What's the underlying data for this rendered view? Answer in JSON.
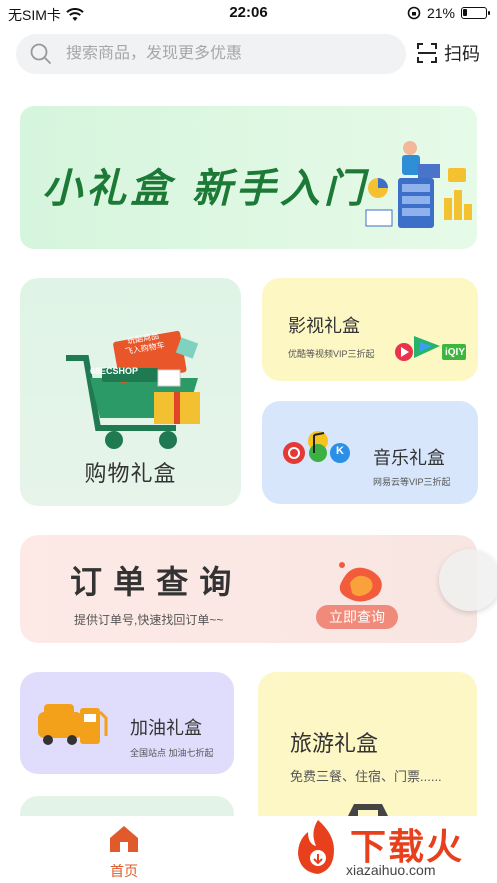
{
  "status_bar": {
    "carrier": "无SIM卡",
    "time": "22:06",
    "battery_text": "21%",
    "battery_level": 0.21
  },
  "search": {
    "placeholder": "搜索商品，发现更多优惠",
    "scan_label": "扫码"
  },
  "banner": {
    "title": "小礼盒  新手入门",
    "slides_total": 2,
    "active_slide": 1
  },
  "cards": {
    "shopping": {
      "title": "购物礼盒",
      "art_cart_line1": "玩酷商品",
      "art_cart_line2": "飞入购物车",
      "art_badge": "68ECSHOP"
    },
    "video": {
      "title": "影视礼盒",
      "subtitle": "优酷等视频VIP三折起",
      "logo_text": "iQIY"
    },
    "music": {
      "title": "音乐礼盒",
      "subtitle": "网易云等VIP三折起",
      "logo_text": "K"
    },
    "order": {
      "title": "订 单 查 询",
      "subtitle": "提供订单号,快速找回订单~~",
      "button": "立即查询"
    },
    "fuel": {
      "title": "加油礼盒",
      "subtitle": "全国站点 加油七折起"
    },
    "travel": {
      "title": "旅游礼盒",
      "subtitle": "免费三餐、住宿、门票......"
    }
  },
  "tabbar": {
    "home_label": "首页"
  },
  "watermark": {
    "text": "下载火",
    "domain": "xiazaihuo.com"
  },
  "colors": {
    "accent": "#e05a2b",
    "banner_green": "#1c7a36",
    "order_button": "#f08a7a"
  }
}
